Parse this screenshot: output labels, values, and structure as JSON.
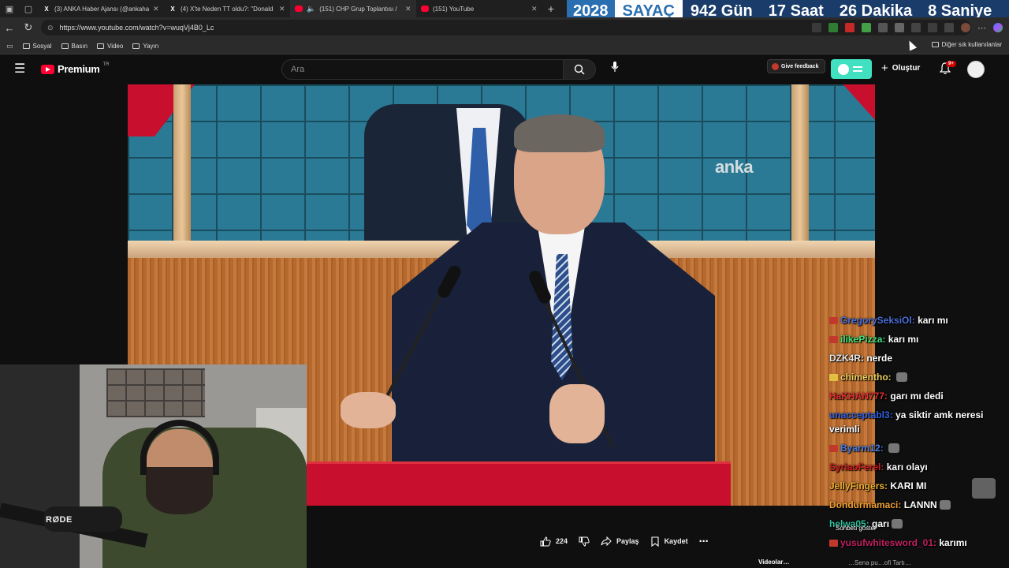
{
  "tabs": [
    {
      "title": "(3) ANKA Haber Ajansı (@ankaha",
      "icon": "x-logo-icon",
      "active": false
    },
    {
      "title": "(4) X'te Neden TT oldu?: \"Donald",
      "icon": "x-logo-icon",
      "active": false
    },
    {
      "title": "(151) CHP Grup Toplantısı / ",
      "icon": "youtube-icon",
      "active": true
    },
    {
      "title": "(151) YouTube",
      "icon": "youtube-icon",
      "active": false
    }
  ],
  "countdown": {
    "year": "2028",
    "label": "SAYAÇ",
    "days": "942 Gün",
    "hours": "17 Saat",
    "minutes": "26 Dakika",
    "seconds": "8 Saniye"
  },
  "url": "https://www.youtube.com/watch?v=wuqVj4B0_Lc",
  "bookmarks": {
    "items": [
      "Sosyal",
      "Basın",
      "Video",
      "Yayın"
    ],
    "other": "Diğer sık kullanılanlar"
  },
  "youtube": {
    "logo_text": "Premium",
    "region": "TR",
    "search_placeholder": "Ara",
    "feedback_label": "Give feedback",
    "create_label": "Oluştur",
    "notification_count": "9+"
  },
  "video": {
    "watermark": "anka"
  },
  "webcam": {
    "mic_brand": "RØDE"
  },
  "chat": [
    {
      "user": "GregorySeksiOl",
      "message": "karı mı",
      "color": "#4a6fd8",
      "badge": "#c0392b"
    },
    {
      "user": "ilikePizza",
      "message": "karı mı",
      "color": "#3de07a",
      "badge": "#c0392b"
    },
    {
      "user": "DZK4R",
      "message": "nerde",
      "color": "#e8e8e8",
      "badge": ""
    },
    {
      "user": "chimentho",
      "message": "",
      "color": "#f0d060",
      "badge": "#e0c040"
    },
    {
      "user": "HaKHAN777",
      "message": "garı mı dedi",
      "color": "#e03030",
      "badge": ""
    },
    {
      "user": "unacceptabl3",
      "message": "ya siktir amk neresi verimli",
      "color": "#3060e0",
      "badge": ""
    },
    {
      "user": "Byarm12",
      "message": "",
      "color": "#4a7fe0",
      "badge": "#c0392b"
    },
    {
      "user": "SyriaoFerel",
      "message": "karı olayı",
      "color": "#d02020",
      "badge": ""
    },
    {
      "user": "JellyFingers",
      "message": "KARI MI",
      "color": "#f0b030",
      "badge": ""
    },
    {
      "user": "Dondurmamaci",
      "message": "LANNN",
      "color": "#f0a030",
      "badge": ""
    },
    {
      "user": "helwa05",
      "message": "garı",
      "color": "#30c0a0",
      "badge": ""
    },
    {
      "user": "yusufwhitesword_01",
      "message": "karımı",
      "color": "#c02060",
      "badge": "#c0392b"
    }
  ],
  "chat_hint": "Sohbeti göster",
  "actions": {
    "likes": "224",
    "share": "Paylaş",
    "save": "Kaydet"
  },
  "bottom": {
    "left": "Videolar…",
    "right": "…Sena pu…ofi   Tartı…"
  }
}
